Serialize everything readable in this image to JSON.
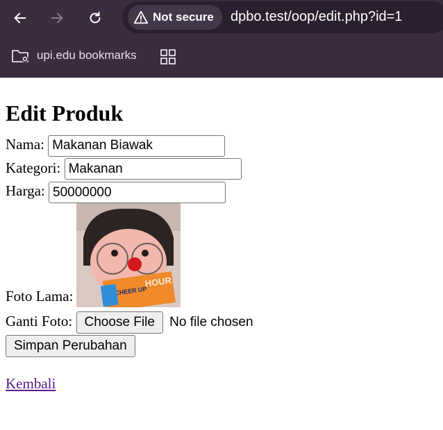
{
  "browser": {
    "security_label": "Not secure",
    "url": "dpbo.test/oop/edit.php?id=1",
    "bookmark_folder": "upi.edu bookmarks",
    "icons": [
      "back-icon",
      "forward-icon",
      "reload-icon",
      "warning-icon",
      "folder-settings-icon",
      "apps-grid-icon"
    ]
  },
  "page": {
    "title": "Edit Produk",
    "form": {
      "nama_label": "Nama:",
      "nama_value": "Makanan Biawak",
      "kategori_label": "Kategori:",
      "kategori_value": "Makanan",
      "harga_label": "Harga:",
      "harga_value": "50000000",
      "foto_lama_label": "Foto Lama:",
      "ganti_foto_label": "Ganti Foto:",
      "choose_file_label": "Choose File",
      "no_file_text": "No file chosen",
      "submit_label": "Simpan Perubahan"
    },
    "back_link": "Kembali"
  },
  "colors": {
    "chrome_bg": "#3b2c40",
    "omnibox_bg": "#2a1f2e",
    "link_visited": "#551a8b"
  }
}
